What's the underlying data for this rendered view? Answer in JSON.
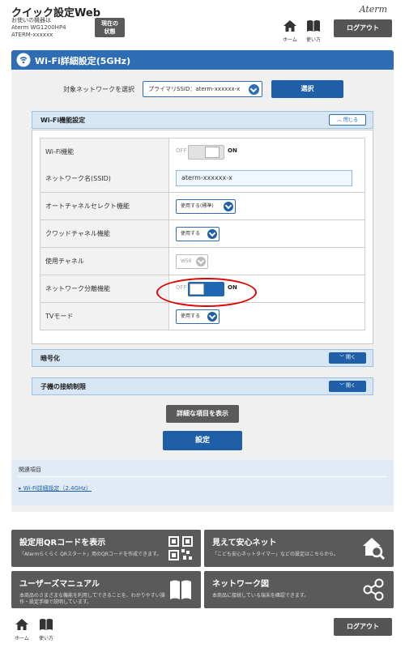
{
  "header": {
    "app_title": "クイック設定Web",
    "device_line1": "お使いの機器は",
    "device_line2": "Aterm WG1200HP4",
    "device_line3": "ATERM-xxxxxx",
    "status_button_line1": "現在の",
    "status_button_line2": "状態",
    "brand": "Aterm",
    "home_label": "ホーム",
    "help_label": "使い方",
    "logout_label": "ログアウト"
  },
  "page": {
    "title": "Wi-Fi詳細設定(5GHz)",
    "target_label": "対象ネットワークを選択",
    "target_value": "プライマリSSID：aterm-xxxxxx-x",
    "select_button": "選択"
  },
  "wifi_section": {
    "title": "Wi-Fi機能設定",
    "close_label": "閉じる",
    "rows": {
      "wifi_function": {
        "label": "Wi-Fi機能",
        "off": "OFF",
        "on": "ON",
        "enabled": false
      },
      "ssid": {
        "label": "ネットワーク名(SSID)",
        "value": "aterm-xxxxxx-x"
      },
      "auto_channel": {
        "label": "オートチャネルセレクト機能",
        "value": "使用する(標準)"
      },
      "quad_channel": {
        "label": "クワッドチャネル機能",
        "value": "使用する"
      },
      "channel": {
        "label": "使用チャネル",
        "value": "W56"
      },
      "separation": {
        "label": "ネットワーク分離機能",
        "off": "OFF",
        "on": "ON",
        "enabled": true
      },
      "tv_mode": {
        "label": "TVモード",
        "value": "使用する"
      }
    }
  },
  "encryption": {
    "title": "暗号化",
    "open_label": "開く"
  },
  "child_limit": {
    "title": "子機の接続制限",
    "open_label": "開く"
  },
  "buttons": {
    "detail": "詳細な項目を表示",
    "save": "設定"
  },
  "related": {
    "title": "関連項目",
    "link": "Wi-Fi詳細設定（2.4GHz）"
  },
  "cards": [
    {
      "title": "設定用QRコードを表示",
      "desc": "「Atermらくらく QRスタート」用のQRコードを作成できます。",
      "icon": "qr-code-icon"
    },
    {
      "title": "見えて安心ネット",
      "desc": "「こども安心ネットタイマー」などの設定はこちらから。",
      "icon": "house-search-icon"
    },
    {
      "title": "ユーザーズマニュアル",
      "desc": "本商品のさまざまな機能を利用してできることを、わかりやすい操作・設定手順で説明しています。",
      "icon": "book-icon"
    },
    {
      "title": "ネットワーク図",
      "desc": "本商品に接続している端末を確認できます。",
      "icon": "network-icon"
    }
  ],
  "colors": {
    "accent": "#2e6db4",
    "dark_button": "#5a5a5a",
    "highlight": "#e00000"
  }
}
